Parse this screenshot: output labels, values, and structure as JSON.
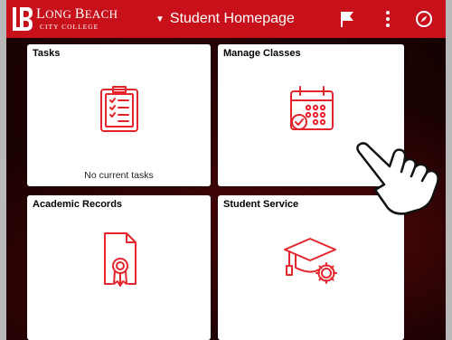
{
  "header": {
    "logo": {
      "line1_initial": "L",
      "line1_rest": "ONG ",
      "line1_initial2": "B",
      "line1_rest2": "EACH",
      "line2": "CITY COLLEGE"
    },
    "page_title": "Student Homepage",
    "icons": [
      "caret-down-icon",
      "flag-icon",
      "more-vertical-icon",
      "compass-icon"
    ]
  },
  "tiles": [
    {
      "title": "Tasks",
      "status": "No current tasks",
      "icon": "clipboard-checklist-icon"
    },
    {
      "title": "Manage Classes",
      "status": "",
      "icon": "calendar-check-icon"
    },
    {
      "title": "Academic Records",
      "status": "",
      "icon": "certificate-document-icon"
    },
    {
      "title": "Student Service",
      "status": "",
      "icon": "graduation-cap-gear-icon"
    }
  ],
  "colors": {
    "brand_red": "#c8101b",
    "icon_red": "#e4262c",
    "background": "#b9b9b9"
  }
}
